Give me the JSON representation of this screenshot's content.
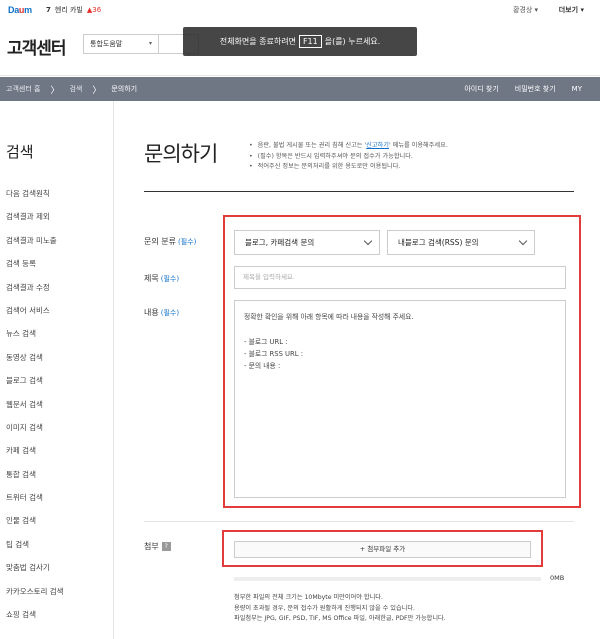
{
  "topbar": {
    "logo_prefix": "Da",
    "logo_mark": "u",
    "logo_suffix": "m",
    "realtime": {
      "rank": "7",
      "keyword": "헨리 카빌",
      "change": "▲36"
    },
    "user_label": "황경상 ▾",
    "more_label": "더보기 ▾"
  },
  "header": {
    "site_title": "고객센터",
    "search_scope": "통합도움말",
    "search_scope_caret": "▾",
    "fullscreen_toast": {
      "before": "전체화면을 종료하려면",
      "key": "F11",
      "after": "을(를) 누르세요."
    }
  },
  "breadcrumb": {
    "items": [
      "고객센터 홈",
      "검색",
      "문의하기"
    ],
    "separator": "〉",
    "right_links": [
      "아이디 찾기",
      "비밀번호 찾기",
      "MY"
    ]
  },
  "sidebar": {
    "title": "검색",
    "items": [
      "다음 검색원칙",
      "검색결과 제외",
      "검색결과 미노출",
      "검색 등록",
      "검색결과 수정",
      "검색어 서비스",
      "뉴스 검색",
      "동영상 검색",
      "블로그 검색",
      "웹문서 검색",
      "이미지 검색",
      "카페 검색",
      "통합 검색",
      "트위터 검색",
      "인물 검색",
      "팁 검색",
      "맞춤법 검사기",
      "카카오스토리 검색",
      "쇼핑 검색"
    ]
  },
  "main": {
    "title": "문의하기",
    "notices": [
      {
        "before": "음란, 불법 게시물 또는 권리 침해 신고는 '",
        "link": "신고하기",
        "after": "' 메뉴를 이용해주세요."
      },
      {
        "before": "(필수) 항목은 반드시 입력하주셔야 문의 접수가 가능합니다.",
        "link": "",
        "after": ""
      },
      {
        "before": "적어주신 정보는 문의처리를 위한 용도로만 이용됩니다.",
        "link": "",
        "after": ""
      }
    ],
    "required_mark": "(필수)",
    "category": {
      "label": "문의 분류",
      "select1": "블로그, 카페검색 문의",
      "select2": "내블로그 검색(RSS) 문의"
    },
    "subject": {
      "label": "제목",
      "placeholder": "제목을 입력하세요."
    },
    "content": {
      "label": "내용",
      "lines": [
        "정확한 확인을 위해 아래 항목에 따라 내용을 작성해 주세요.",
        "",
        "- 블로그 URL :",
        "- 블로그 RSS URL :",
        "- 문의 내용 :"
      ]
    },
    "attachment": {
      "label": "첨부",
      "help_icon": "?",
      "button": "+ 첨부파일 추가",
      "progress": 0,
      "size": "0MB",
      "notes": [
        "첨부한 파일의 전체 크기는 10Mbyte 미만이어야 합니다.",
        "용량이 초과될 경우, 문의 접수가 원활하게 진행되지 않을 수 있습니다.",
        "파일첨부는 JPG, GIF, PSD, TIF, MS Office 파일, 아래한글, PDF만 가능합니다."
      ]
    }
  },
  "colors": {
    "accent": "#0f71c9",
    "highlight_box": "#e23b3b",
    "breadcrumb_bg": "#6f7785"
  }
}
